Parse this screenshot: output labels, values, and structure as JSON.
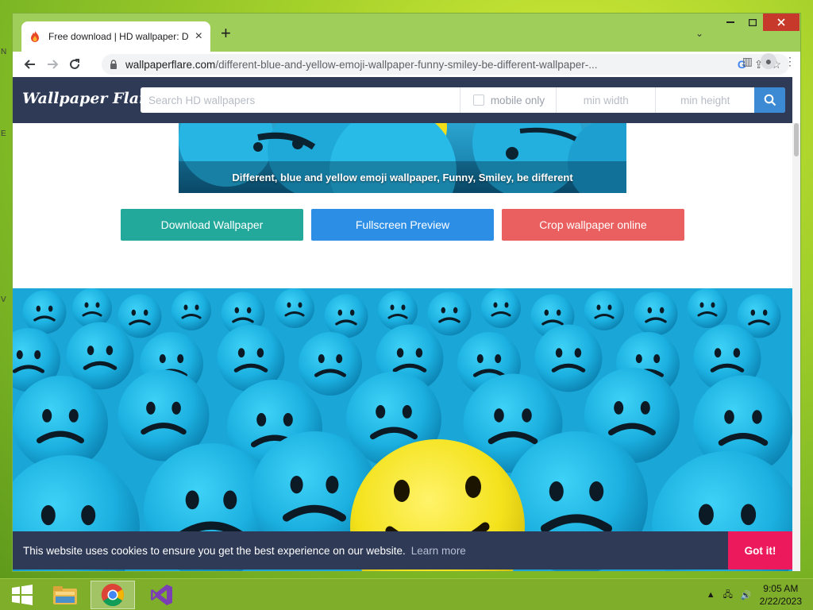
{
  "browser": {
    "tab_title": "Free download | HD wallpaper: D",
    "new_tab": "+",
    "url_host": "wallpaperflare.com",
    "url_path": "/different-blue-and-yellow-emoji-wallpaper-funny-smiley-be-different-wallpaper-..."
  },
  "site": {
    "logo": "Wallpaper Flare",
    "search_placeholder": "Search HD wallpapers",
    "mobile_only_label": "mobile only",
    "min_width_placeholder": "min width",
    "min_height_placeholder": "min height"
  },
  "wallpaper": {
    "caption": "Different, blue and yellow emoji wallpaper, Funny, Smiley, be different"
  },
  "actions": {
    "download_label": "Download Wallpaper",
    "fullscreen_label": "Fullscreen Preview",
    "crop_label": "Crop wallpaper online"
  },
  "cookie": {
    "message": "This website uses cookies to ensure you get the best experience on our website.",
    "learn_more": "Learn more",
    "button": "Got it!"
  },
  "taskbar": {
    "time": "9:05 AM",
    "date": "2/22/2023"
  },
  "colors": {
    "header_bg": "#2e3a56",
    "download_btn": "#22a99b",
    "fullscreen_btn": "#2d8ee6",
    "crop_btn": "#ea5f5f",
    "cookie_btn": "#ec1a5c",
    "window_frame": "#9fce5a"
  }
}
